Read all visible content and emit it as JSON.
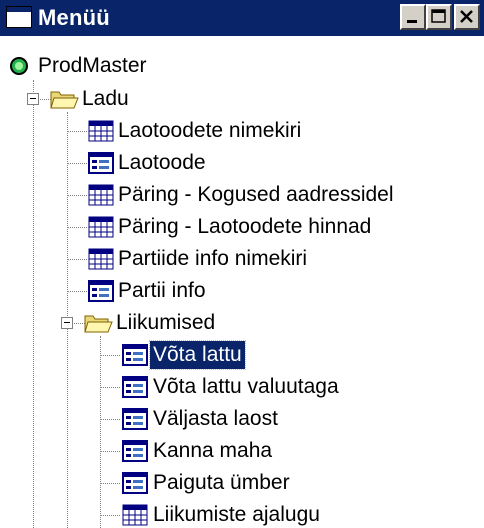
{
  "window": {
    "title": "Menüü",
    "buttons": {
      "minimize": "minimize",
      "maximize": "maximize",
      "close": "close"
    }
  },
  "tree": {
    "root": {
      "label": "ProdMaster",
      "icon": "green-circle-icon"
    },
    "ladu": {
      "label": "Ladu",
      "icon": "folder-open-icon",
      "items": [
        {
          "label": "Laotoodete nimekiri",
          "icon": "grid-icon"
        },
        {
          "label": "Laotoode",
          "icon": "form-icon"
        },
        {
          "label": "Päring - Kogused aadressidel",
          "icon": "grid-icon"
        },
        {
          "label": "Päring - Laotoodete hinnad",
          "icon": "grid-icon"
        },
        {
          "label": "Partiide info nimekiri",
          "icon": "grid-icon"
        },
        {
          "label": "Partii info",
          "icon": "form-icon"
        }
      ],
      "liikumised": {
        "label": "Liikumised",
        "icon": "folder-open-icon",
        "items": [
          {
            "label": "Võta lattu",
            "icon": "form-icon",
            "selected": true
          },
          {
            "label": "Võta lattu valuutaga",
            "icon": "form-icon"
          },
          {
            "label": "Väljasta laost",
            "icon": "form-icon"
          },
          {
            "label": "Kanna maha",
            "icon": "form-icon"
          },
          {
            "label": "Paiguta ümber",
            "icon": "form-icon"
          },
          {
            "label": "Liikumiste ajalugu",
            "icon": "grid-icon"
          }
        ]
      }
    }
  },
  "colors": {
    "titlebar": "#0a246a",
    "selection": "#0a246a",
    "chrome": "#d4d0c8"
  }
}
